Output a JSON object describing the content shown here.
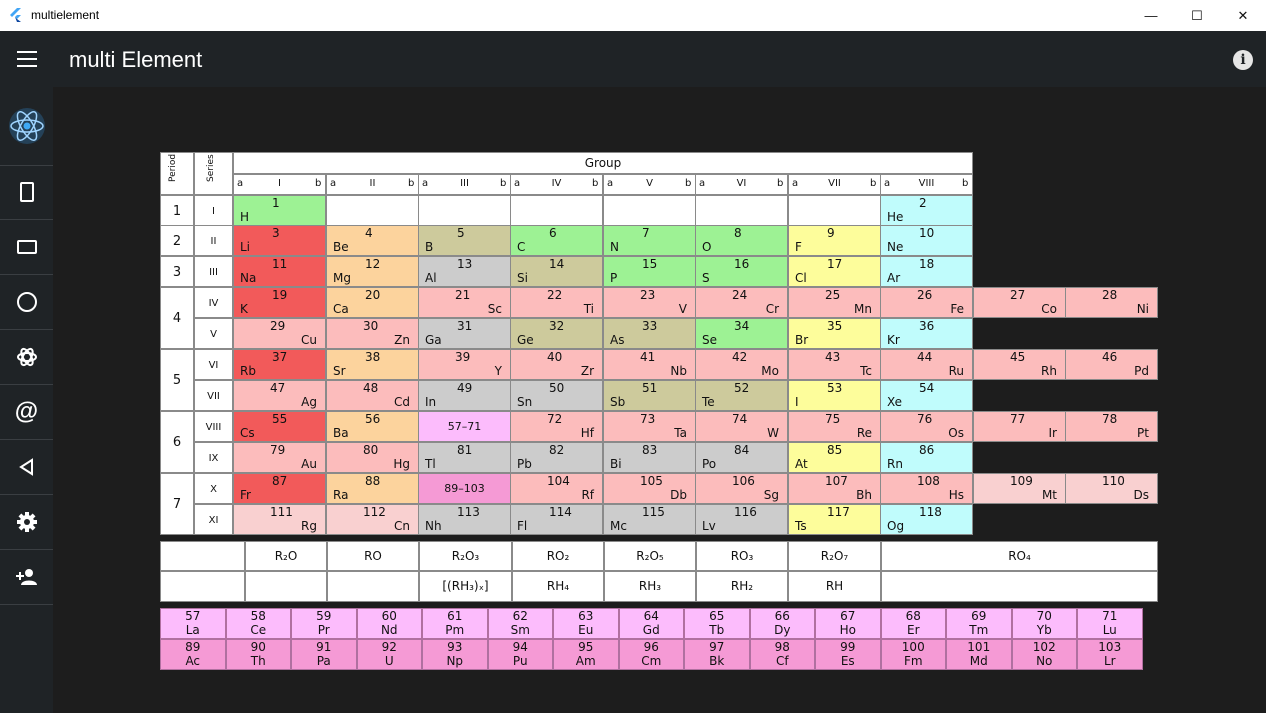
{
  "window": {
    "title": "multielement",
    "minimize": "—",
    "maximize": "☐",
    "close": "✕"
  },
  "appbar": {
    "title": "multi Element"
  },
  "rail": {
    "items": [
      "atom-logo",
      "portrait-icon",
      "landscape-icon",
      "circle-icon",
      "molecule-icon",
      "at-icon",
      "back-triangle-icon",
      "settings-icon",
      "person-add-icon"
    ]
  },
  "colors": {
    "alkali": "#f25a5a",
    "alkaline": "#fcd39d",
    "metalloid": "#cdca9c",
    "nonmetal": "#9df294",
    "halogen": "#fdfd9b",
    "noble": "#c0fcfc",
    "transition": "#fcbcbc",
    "post": "#cccccc",
    "lanthanide": "#fcbcfc",
    "actinide": "#f59ad5",
    "unknown": "#f9d0d0",
    "empty": "#ffffff"
  },
  "table": {
    "group_label": "Group",
    "period_label": "Period",
    "series_label": "Series",
    "subgroups": [
      "I",
      "II",
      "III",
      "IV",
      "V",
      "VI",
      "VII",
      "VIII"
    ],
    "periods": [
      "1",
      "2",
      "3",
      "4",
      "5",
      "6",
      "7"
    ],
    "series": [
      "I",
      "II",
      "III",
      "IV",
      "V",
      "VI",
      "VII",
      "VIII",
      "IX",
      "X",
      "XI"
    ],
    "rows": [
      [
        [
          "1",
          "H",
          "nonmetal",
          "L"
        ],
        null,
        null,
        null,
        null,
        null,
        null,
        [
          "2",
          "He",
          "noble",
          "L"
        ]
      ],
      [
        [
          "3",
          "Li",
          "alkali",
          "L"
        ],
        [
          "4",
          "Be",
          "alkaline",
          "L"
        ],
        [
          "5",
          "B",
          "metalloid",
          "L"
        ],
        [
          "6",
          "C",
          "nonmetal",
          "L"
        ],
        [
          "7",
          "N",
          "nonmetal",
          "L"
        ],
        [
          "8",
          "O",
          "nonmetal",
          "L"
        ],
        [
          "9",
          "F",
          "halogen",
          "L"
        ],
        [
          "10",
          "Ne",
          "noble",
          "L"
        ]
      ],
      [
        [
          "11",
          "Na",
          "alkali",
          "L"
        ],
        [
          "12",
          "Mg",
          "alkaline",
          "L"
        ],
        [
          "13",
          "Al",
          "post",
          "L"
        ],
        [
          "14",
          "Si",
          "metalloid",
          "L"
        ],
        [
          "15",
          "P",
          "nonmetal",
          "L"
        ],
        [
          "16",
          "S",
          "nonmetal",
          "L"
        ],
        [
          "17",
          "Cl",
          "halogen",
          "L"
        ],
        [
          "18",
          "Ar",
          "noble",
          "L"
        ]
      ],
      [
        [
          "19",
          "K",
          "alkali",
          "L"
        ],
        [
          "20",
          "Ca",
          "alkaline",
          "L"
        ],
        [
          "21",
          "Sc",
          "transition",
          "R"
        ],
        [
          "22",
          "Ti",
          "transition",
          "R"
        ],
        [
          "23",
          "V",
          "transition",
          "R"
        ],
        [
          "24",
          "Cr",
          "transition",
          "R"
        ],
        [
          "25",
          "Mn",
          "transition",
          "R"
        ],
        [
          "26",
          "Fe",
          "transition",
          "R"
        ],
        [
          "27",
          "Co",
          "transition",
          "R"
        ],
        [
          "28",
          "Ni",
          "transition",
          "R"
        ]
      ],
      [
        [
          "29",
          "Cu",
          "transition",
          "R"
        ],
        [
          "30",
          "Zn",
          "transition",
          "R"
        ],
        [
          "31",
          "Ga",
          "post",
          "L"
        ],
        [
          "32",
          "Ge",
          "metalloid",
          "L"
        ],
        [
          "33",
          "As",
          "metalloid",
          "L"
        ],
        [
          "34",
          "Se",
          "nonmetal",
          "L"
        ],
        [
          "35",
          "Br",
          "halogen",
          "L"
        ],
        [
          "36",
          "Kr",
          "noble",
          "L"
        ]
      ],
      [
        [
          "37",
          "Rb",
          "alkali",
          "L"
        ],
        [
          "38",
          "Sr",
          "alkaline",
          "L"
        ],
        [
          "39",
          "Y",
          "transition",
          "R"
        ],
        [
          "40",
          "Zr",
          "transition",
          "R"
        ],
        [
          "41",
          "Nb",
          "transition",
          "R"
        ],
        [
          "42",
          "Mo",
          "transition",
          "R"
        ],
        [
          "43",
          "Tc",
          "transition",
          "R"
        ],
        [
          "44",
          "Ru",
          "transition",
          "R"
        ],
        [
          "45",
          "Rh",
          "transition",
          "R"
        ],
        [
          "46",
          "Pd",
          "transition",
          "R"
        ]
      ],
      [
        [
          "47",
          "Ag",
          "transition",
          "R"
        ],
        [
          "48",
          "Cd",
          "transition",
          "R"
        ],
        [
          "49",
          "In",
          "post",
          "L"
        ],
        [
          "50",
          "Sn",
          "post",
          "L"
        ],
        [
          "51",
          "Sb",
          "metalloid",
          "L"
        ],
        [
          "52",
          "Te",
          "metalloid",
          "L"
        ],
        [
          "53",
          "I",
          "halogen",
          "L"
        ],
        [
          "54",
          "Xe",
          "noble",
          "L"
        ]
      ],
      [
        [
          "55",
          "Cs",
          "alkali",
          "L"
        ],
        [
          "56",
          "Ba",
          "alkaline",
          "L"
        ],
        [
          "57–71",
          "",
          "lanthanide",
          "C"
        ],
        [
          "72",
          "Hf",
          "transition",
          "R"
        ],
        [
          "73",
          "Ta",
          "transition",
          "R"
        ],
        [
          "74",
          "W",
          "transition",
          "R"
        ],
        [
          "75",
          "Re",
          "transition",
          "R"
        ],
        [
          "76",
          "Os",
          "transition",
          "R"
        ],
        [
          "77",
          "Ir",
          "transition",
          "R"
        ],
        [
          "78",
          "Pt",
          "transition",
          "R"
        ]
      ],
      [
        [
          "79",
          "Au",
          "transition",
          "R"
        ],
        [
          "80",
          "Hg",
          "transition",
          "R"
        ],
        [
          "81",
          "Tl",
          "post",
          "L"
        ],
        [
          "82",
          "Pb",
          "post",
          "L"
        ],
        [
          "83",
          "Bi",
          "post",
          "L"
        ],
        [
          "84",
          "Po",
          "post",
          "L"
        ],
        [
          "85",
          "At",
          "halogen",
          "L"
        ],
        [
          "86",
          "Rn",
          "noble",
          "L"
        ]
      ],
      [
        [
          "87",
          "Fr",
          "alkali",
          "L"
        ],
        [
          "88",
          "Ra",
          "alkaline",
          "L"
        ],
        [
          "89–103",
          "",
          "actinide",
          "C"
        ],
        [
          "104",
          "Rf",
          "transition",
          "R"
        ],
        [
          "105",
          "Db",
          "transition",
          "R"
        ],
        [
          "106",
          "Sg",
          "transition",
          "R"
        ],
        [
          "107",
          "Bh",
          "transition",
          "R"
        ],
        [
          "108",
          "Hs",
          "transition",
          "R"
        ],
        [
          "109",
          "Mt",
          "unknown",
          "R"
        ],
        [
          "110",
          "Ds",
          "unknown",
          "R"
        ]
      ],
      [
        [
          "111",
          "Rg",
          "unknown",
          "R"
        ],
        [
          "112",
          "Cn",
          "unknown",
          "R"
        ],
        [
          "113",
          "Nh",
          "post",
          "L"
        ],
        [
          "114",
          "Fl",
          "post",
          "L"
        ],
        [
          "115",
          "Mc",
          "post",
          "L"
        ],
        [
          "116",
          "Lv",
          "post",
          "L"
        ],
        [
          "117",
          "Ts",
          "halogen",
          "L"
        ],
        [
          "118",
          "Og",
          "noble",
          "L"
        ]
      ]
    ],
    "oxides": [
      "R₂O",
      "RO",
      "R₂O₃",
      "RO₂",
      "R₂O₅",
      "RO₃",
      "R₂O₇",
      "RO₄"
    ],
    "hydrides": [
      "",
      "",
      "[(RH₃)ₓ]",
      "RH₄",
      "RH₃",
      "RH₂",
      "RH",
      ""
    ],
    "lanthanides": [
      [
        "57",
        "La"
      ],
      [
        "58",
        "Ce"
      ],
      [
        "59",
        "Pr"
      ],
      [
        "60",
        "Nd"
      ],
      [
        "61",
        "Pm"
      ],
      [
        "62",
        "Sm"
      ],
      [
        "63",
        "Eu"
      ],
      [
        "64",
        "Gd"
      ],
      [
        "65",
        "Tb"
      ],
      [
        "66",
        "Dy"
      ],
      [
        "67",
        "Ho"
      ],
      [
        "68",
        "Er"
      ],
      [
        "69",
        "Tm"
      ],
      [
        "70",
        "Yb"
      ],
      [
        "71",
        "Lu"
      ]
    ],
    "actinides": [
      [
        "89",
        "Ac"
      ],
      [
        "90",
        "Th"
      ],
      [
        "91",
        "Pa"
      ],
      [
        "92",
        "U"
      ],
      [
        "93",
        "Np"
      ],
      [
        "94",
        "Pu"
      ],
      [
        "95",
        "Am"
      ],
      [
        "96",
        "Cm"
      ],
      [
        "97",
        "Bk"
      ],
      [
        "98",
        "Cf"
      ],
      [
        "99",
        "Es"
      ],
      [
        "100",
        "Fm"
      ],
      [
        "101",
        "Md"
      ],
      [
        "102",
        "No"
      ],
      [
        "103",
        "Lr"
      ]
    ]
  }
}
